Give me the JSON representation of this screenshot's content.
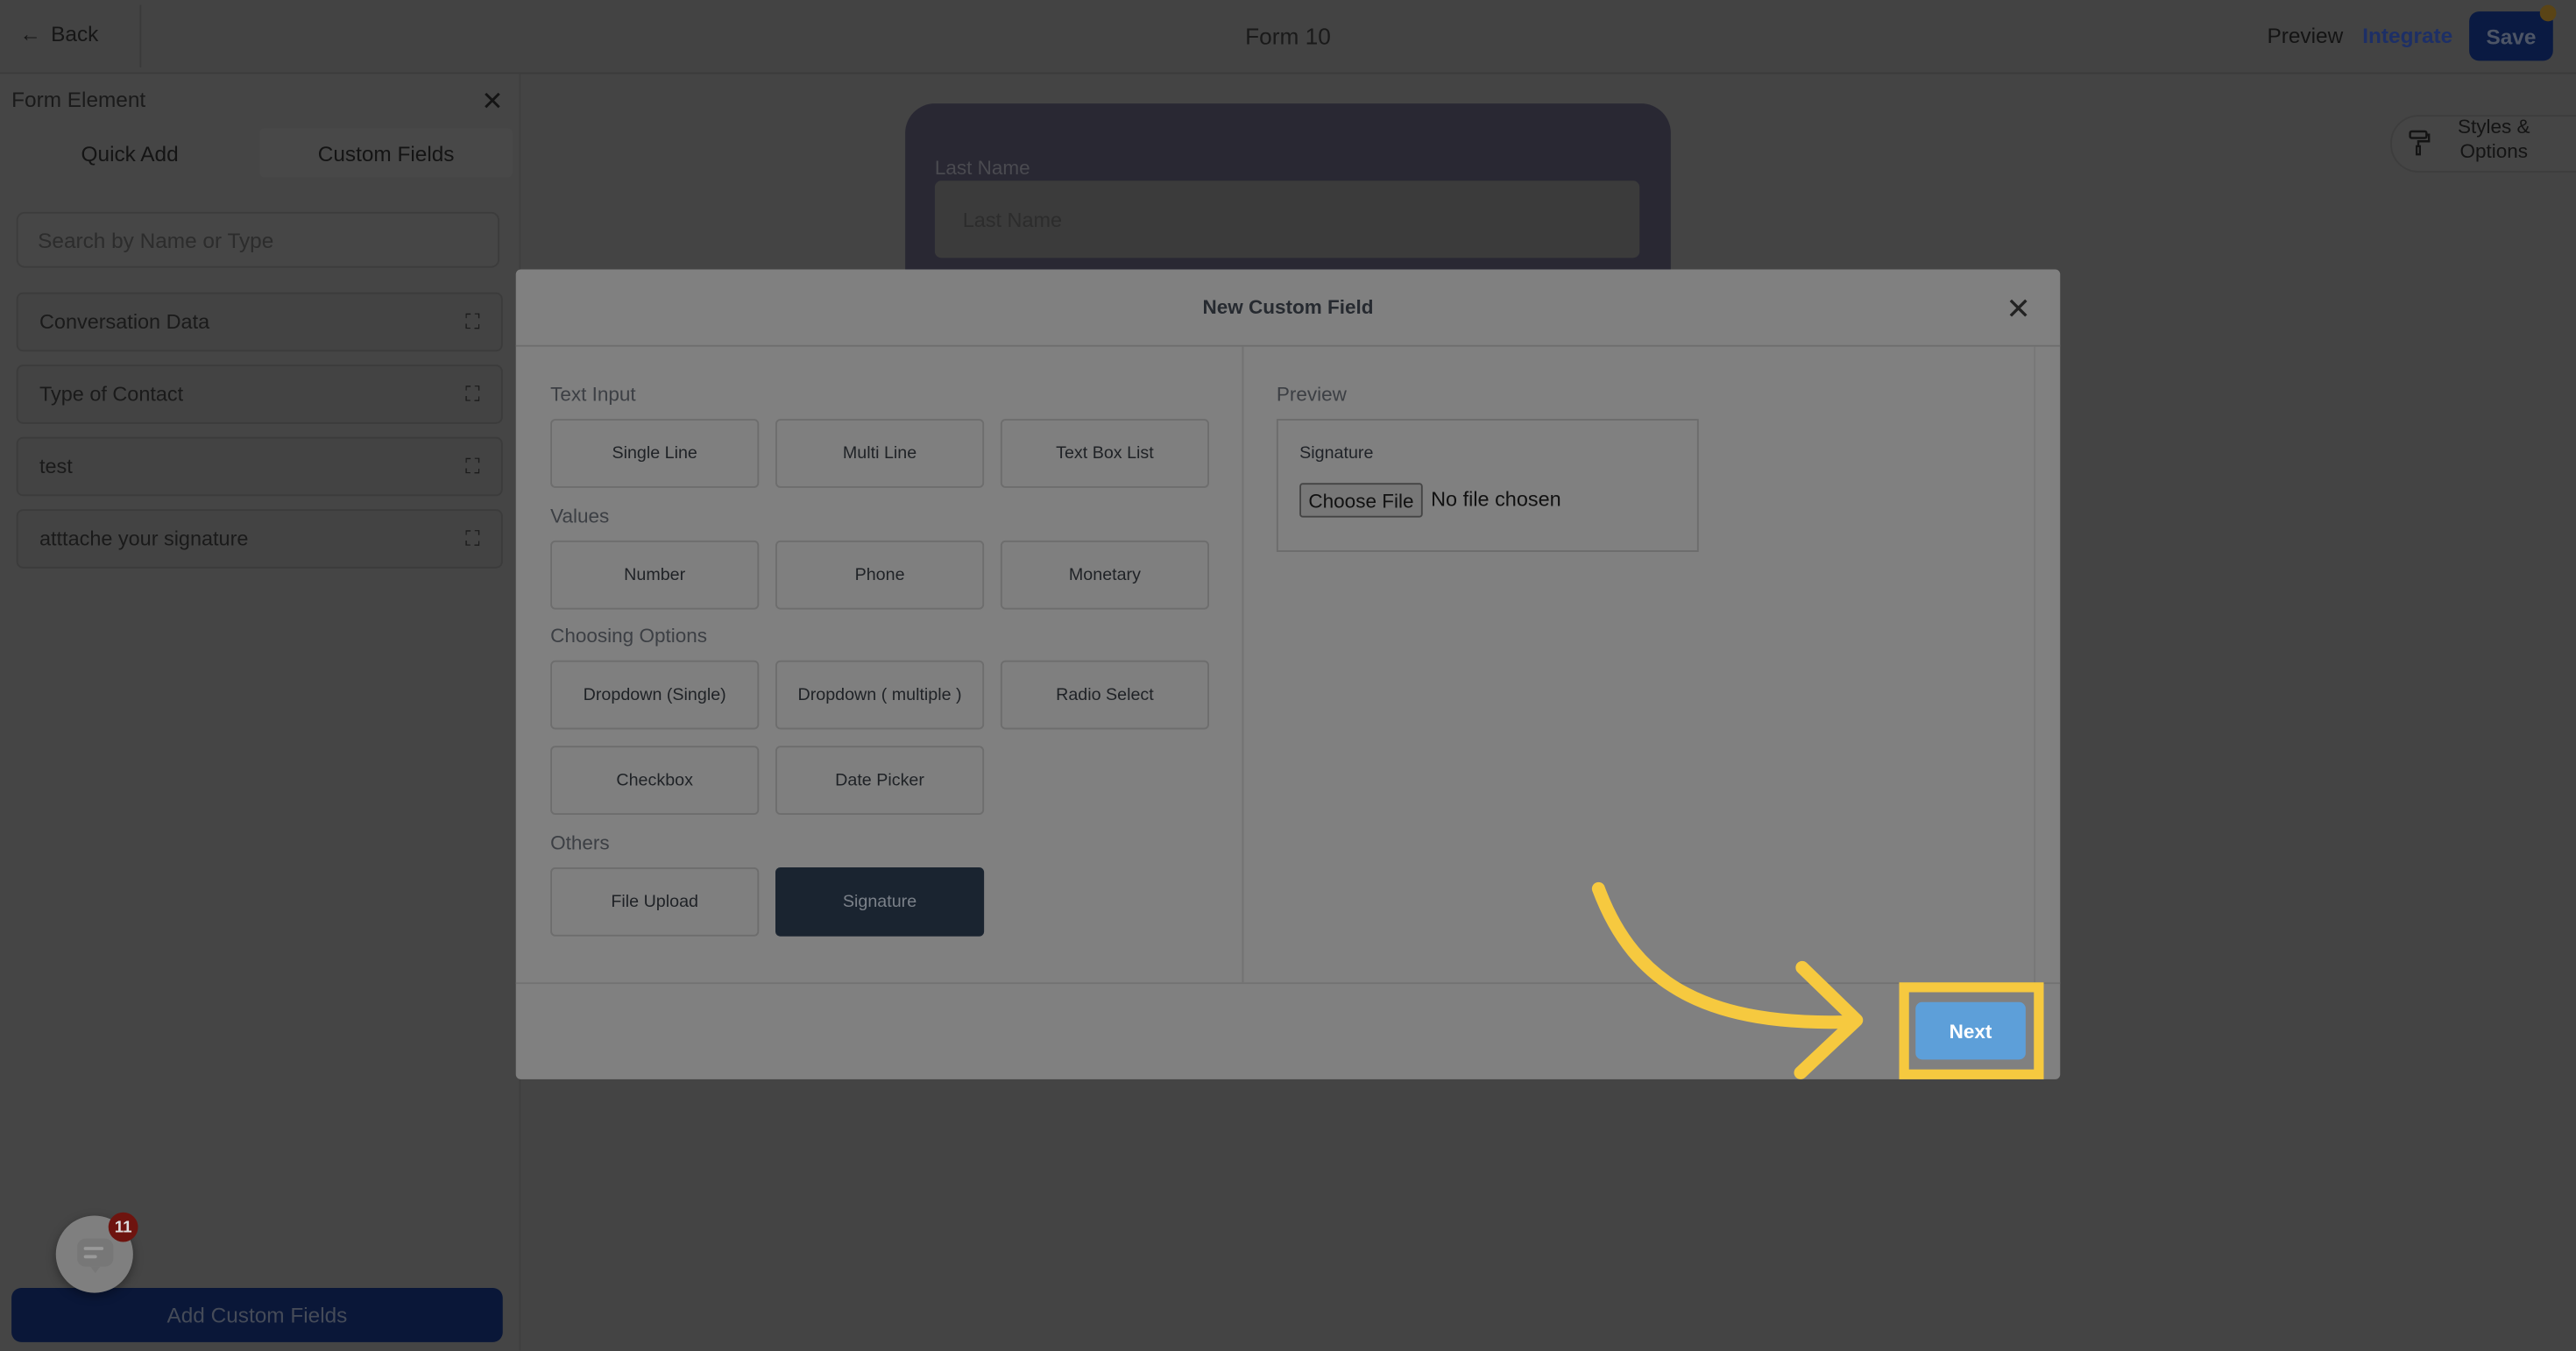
{
  "topbar": {
    "back_label": "Back",
    "title": "Form 10",
    "preview_label": "Preview",
    "integrate_label": "Integrate",
    "save_label": "Save"
  },
  "panel": {
    "title": "Form Element",
    "tabs": [
      "Quick Add",
      "Custom Fields"
    ],
    "search_placeholder": "Search by Name or Type",
    "items": [
      "Conversation Data",
      "Type of Contact",
      "test",
      "atttache your signature"
    ],
    "add_button": "Add Custom Fields",
    "chat_badge": "11"
  },
  "canvas": {
    "field_label": "Last Name",
    "field_placeholder": "Last Name",
    "styles_button": "Styles & Options"
  },
  "modal": {
    "title": "New Custom Field",
    "sections": [
      {
        "label": "Text Input",
        "options": [
          "Single Line",
          "Multi Line",
          "Text Box List"
        ]
      },
      {
        "label": "Values",
        "options": [
          "Number",
          "Phone",
          "Monetary"
        ]
      },
      {
        "label": "Choosing Options",
        "options": [
          "Dropdown (Single)",
          "Dropdown ( multiple )",
          "Radio Select",
          "Checkbox",
          "Date Picker"
        ]
      },
      {
        "label": "Others",
        "options": [
          "File Upload",
          "Signature"
        ]
      }
    ],
    "selected": "Signature",
    "preview": {
      "label": "Preview",
      "field_label": "Signature",
      "choose_file": "Choose File",
      "no_file": "No file chosen"
    },
    "next_label": "Next"
  },
  "colors": {
    "highlight": "#f6c93f",
    "next_button": "#5d9fd9",
    "selected_option": "#1a2430",
    "save_button": "#0a1a42"
  }
}
